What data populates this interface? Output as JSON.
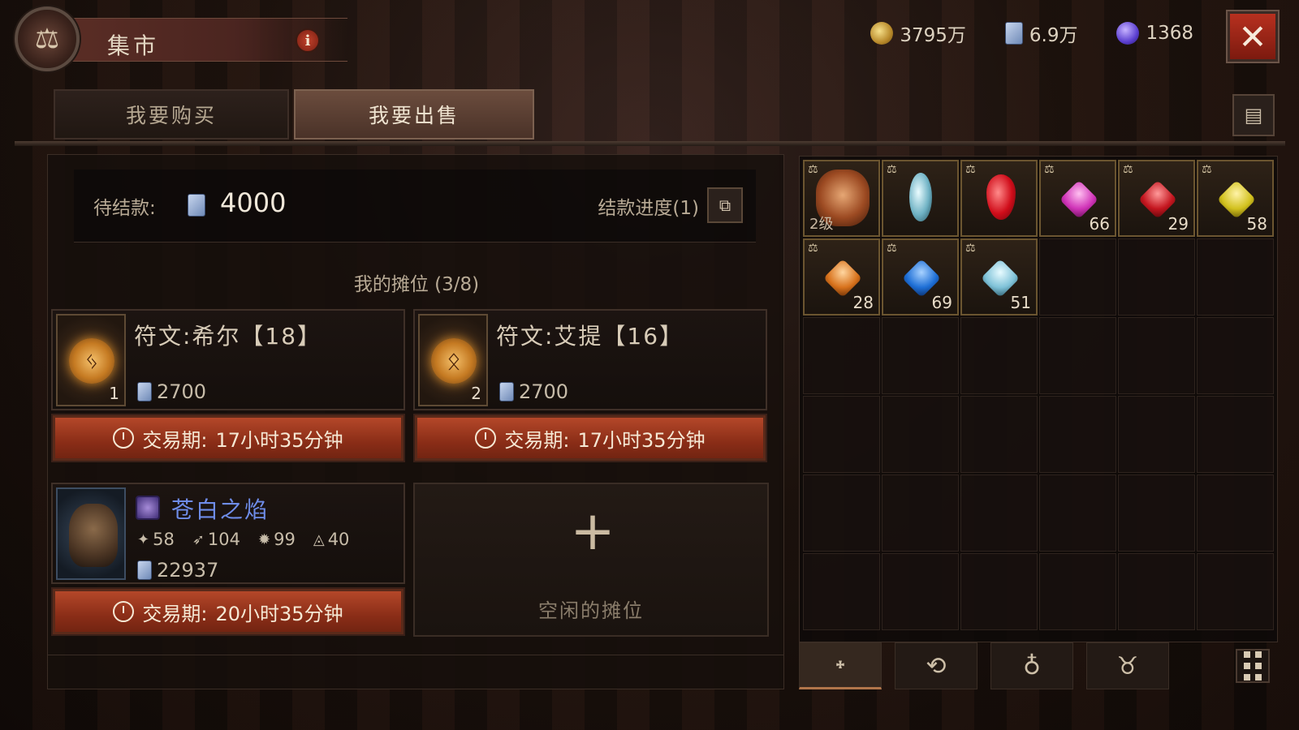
{
  "header": {
    "title": "集市",
    "info_icon": "info-icon",
    "currencies": [
      {
        "icon": "gold-coin-icon",
        "value": "3795万"
      },
      {
        "icon": "note-icon",
        "value": "6.9万"
      },
      {
        "icon": "orb-icon",
        "value": "1368"
      }
    ],
    "close_icon": "close-icon"
  },
  "tabs": [
    {
      "label": "我要购买",
      "active": false
    },
    {
      "label": "我要出售",
      "active": true
    }
  ],
  "settlement": {
    "label": "待结款:",
    "amount": "4000",
    "progress_label": "结款进度(1)"
  },
  "stalls": {
    "title": "我的摊位 (3/8)",
    "items": [
      {
        "name": "符文:希尔【18】",
        "count": "1",
        "price": "2700",
        "timer_label": "交易期:",
        "timer_value": "17小时35分钟"
      },
      {
        "name": "符文:艾提【16】",
        "count": "2",
        "price": "2700",
        "timer_label": "交易期:",
        "timer_value": "17小时35分钟"
      },
      {
        "name": "苍白之焰",
        "stats": [
          "58",
          "104",
          "99",
          "40"
        ],
        "stat_symbols": [
          "✦",
          "➶",
          "✹",
          "◬"
        ],
        "price": "22937",
        "timer_label": "交易期:",
        "timer_value": "20小时35分钟"
      }
    ],
    "empty_label": "空闲的摊位",
    "plus": "+"
  },
  "inventory": {
    "scale_mark": "⚖",
    "items": [
      {
        "type": "amulet",
        "level": "2级",
        "qty": ""
      },
      {
        "type": "crystal",
        "qty": ""
      },
      {
        "type": "ruby-drop",
        "qty": ""
      },
      {
        "type": "pink",
        "qty": "66"
      },
      {
        "type": "red",
        "qty": "29"
      },
      {
        "type": "yellow",
        "qty": "58"
      },
      {
        "type": "orange",
        "qty": "28"
      },
      {
        "type": "blue",
        "qty": "69"
      },
      {
        "type": "ice",
        "qty": "51"
      }
    ],
    "tabs": [
      {
        "icon": "rune-tab-icon",
        "glyph": "᛭",
        "active": true
      },
      {
        "icon": "gem-tab-icon",
        "glyph": "⟲",
        "active": false
      },
      {
        "icon": "bag-tab-icon",
        "glyph": "♁",
        "active": false
      },
      {
        "icon": "demon-tab-icon",
        "glyph": "♉",
        "active": false
      }
    ]
  },
  "colors": {
    "accent_red": "#b84a2b",
    "item_blue": "#6e8ce8",
    "text_main": "#cfc2ad"
  }
}
